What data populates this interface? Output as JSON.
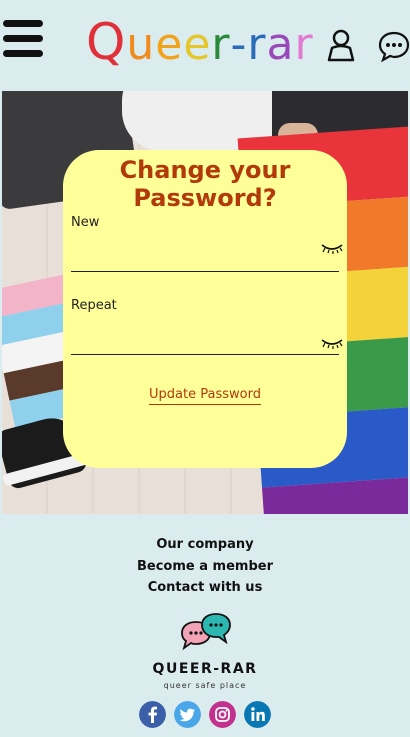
{
  "header": {
    "logo_text": "Queer-rar",
    "logo_letters": [
      {
        "ch": "Q",
        "color": "#e0303a"
      },
      {
        "ch": "u",
        "color": "#f08a1a"
      },
      {
        "ch": "e",
        "color": "#f3a21b"
      },
      {
        "ch": "e",
        "color": "#e6c72b"
      },
      {
        "ch": "r",
        "color": "#2a8a3a"
      },
      {
        "ch": "-",
        "color": "#2a6ab8"
      },
      {
        "ch": "r",
        "color": "#2a6ab8"
      },
      {
        "ch": "a",
        "color": "#9a4ab8"
      },
      {
        "ch": "r",
        "color": "#e27ad2"
      }
    ],
    "icons": [
      "menu-icon",
      "user-icon",
      "chat-icon"
    ]
  },
  "form": {
    "title_line1": "Change your",
    "title_line2": "Password?",
    "new_label": "New",
    "repeat_label": "Repeat",
    "new_value": "",
    "repeat_value": "",
    "submit_label": "Update Password"
  },
  "footer": {
    "links": [
      "Our company",
      "Become a member",
      "Contact with us"
    ],
    "brand": "QUEER-RAR",
    "tagline": "queer safe place",
    "social_icons": [
      "facebook-icon",
      "twitter-icon",
      "instagram-icon",
      "linkedin-icon"
    ]
  },
  "colors": {
    "background": "#dbecef",
    "card": "#ffff99",
    "accent": "#b23a0a"
  }
}
